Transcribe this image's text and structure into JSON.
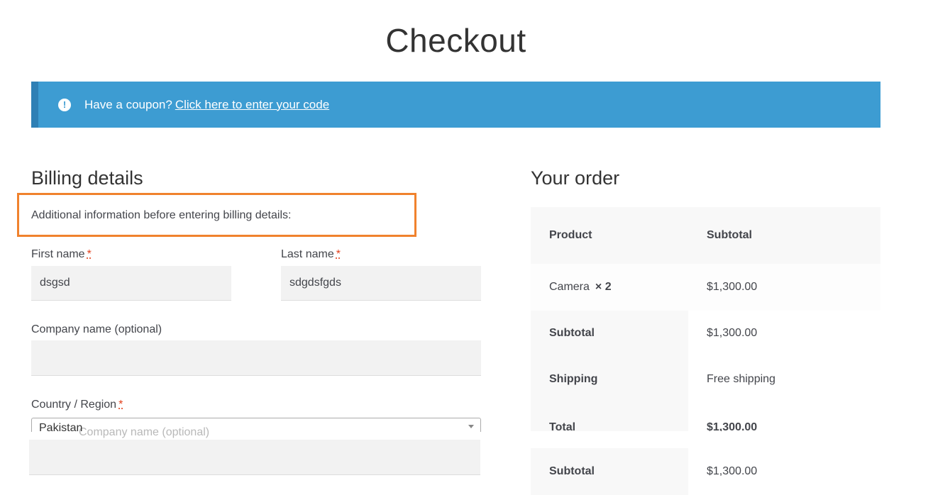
{
  "page": {
    "title": "Checkout"
  },
  "notice": {
    "icon": "info-icon",
    "text": "Have a coupon?",
    "link": "Click here to enter your code"
  },
  "billing": {
    "title": "Billing details",
    "info_text": "Additional information before entering billing details:",
    "first_name_label": "First name",
    "first_name_value": "dsgsd",
    "last_name_label": "Last name",
    "last_name_value": "sdgdsfgds",
    "company_label": "Company name (optional)",
    "company_value": "",
    "country_label": "Country / Region",
    "country_value": "Pakistan",
    "ghost_company_label": "Company name (optional)",
    "required_mark": "*"
  },
  "order": {
    "title": "Your order",
    "header_product": "Product",
    "header_subtotal": "Subtotal",
    "item_name": "Camera",
    "item_qty": "× 2",
    "item_total": "$1,300.00",
    "subtotal_label": "Subtotal",
    "subtotal_value": "$1,300.00",
    "shipping_label": "Shipping",
    "shipping_value": "Free shipping",
    "total_label": "Total",
    "total_value": "$1,300.00",
    "dup_subtotal_label": "Subtotal",
    "dup_subtotal_value": "$1,300.00"
  },
  "colors": {
    "notice_bg": "#3d9cd2",
    "highlight_border": "#f0822d",
    "required": "#e2401c",
    "field_bg": "#f2f2f2",
    "table_shade": "#f8f8f8"
  }
}
